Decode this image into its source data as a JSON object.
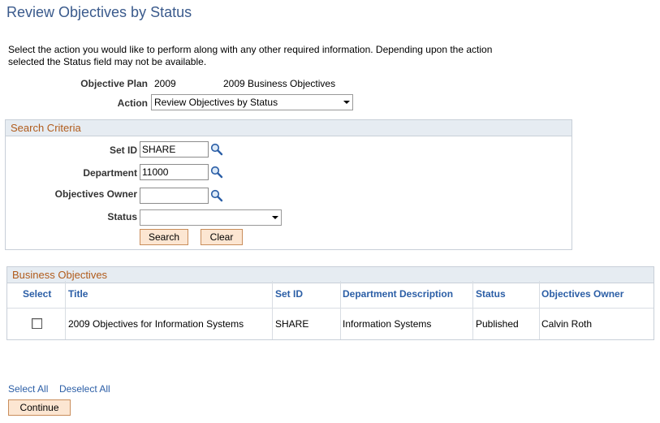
{
  "page": {
    "title": "Review Objectives by Status",
    "intro": "Select the action you would like to perform along with any other required information. Depending upon the action selected the Status field may not be available."
  },
  "plan": {
    "label": "Objective Plan",
    "code": "2009",
    "description": "2009 Business Objectives"
  },
  "action": {
    "label": "Action",
    "value": "Review Objectives by Status"
  },
  "search": {
    "header": "Search Criteria",
    "setid_label": "Set ID",
    "setid_value": "SHARE",
    "department_label": "Department",
    "department_value": "11000",
    "owner_label": "Objectives Owner",
    "owner_value": "",
    "status_label": "Status",
    "status_value": "",
    "search_button": "Search",
    "clear_button": "Clear"
  },
  "grid": {
    "header": "Business Objectives",
    "columns": {
      "select": "Select",
      "title": "Title",
      "setid": "Set ID",
      "dept": "Department Description",
      "status": "Status",
      "owner": "Objectives Owner"
    },
    "rows": [
      {
        "checked": false,
        "title": "2009 Objectives for Information Systems",
        "setid": "SHARE",
        "dept": "Information Systems",
        "status": "Published",
        "owner": "Calvin Roth"
      }
    ]
  },
  "footer": {
    "select_all": "Select All",
    "deselect_all": "Deselect All",
    "continue_button": "Continue"
  },
  "icons": {
    "lookup": "magnifier-lookup-icon",
    "dropdown": "chevron-down-icon"
  },
  "colors": {
    "title": "#3a5a8c",
    "panel_header_text": "#b05b1b",
    "link": "#2b5ea6",
    "button_bg": "#fce6d2"
  }
}
